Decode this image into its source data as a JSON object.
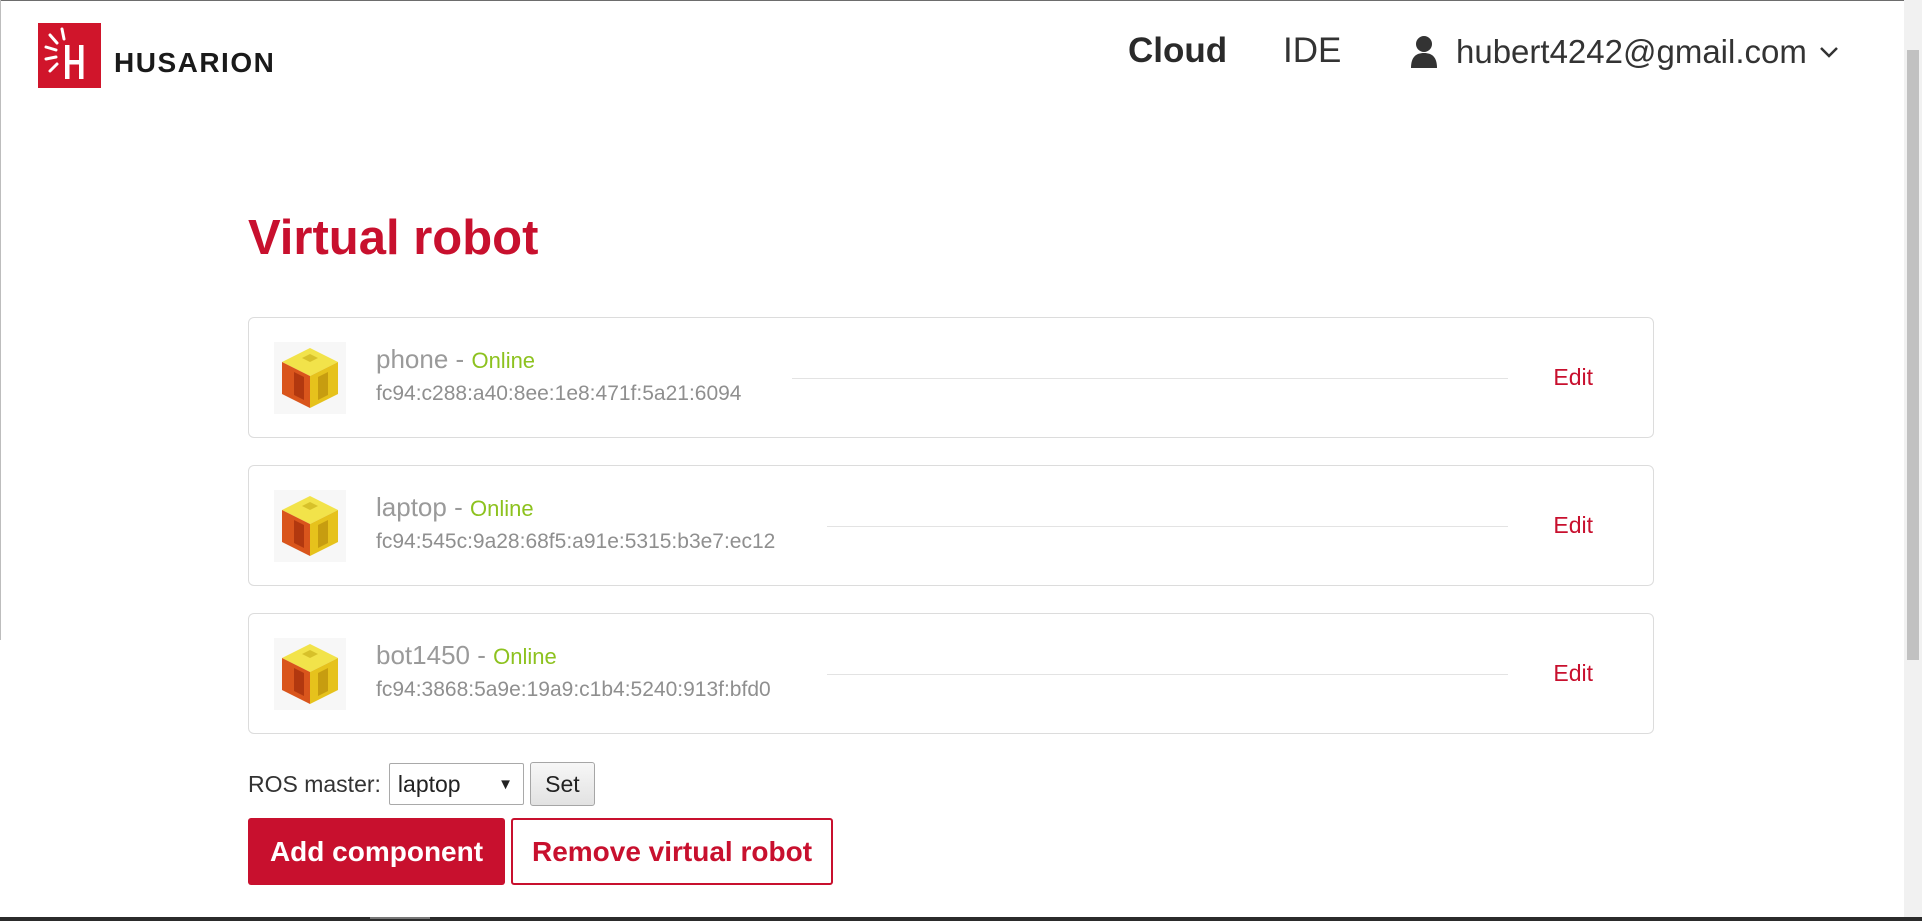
{
  "header": {
    "brand": "HUSARION",
    "nav": [
      {
        "label": "Cloud",
        "active": true
      },
      {
        "label": "IDE",
        "active": false
      }
    ],
    "user": {
      "email": "hubert4242@gmail.com",
      "icon": "user-icon",
      "menu_icon": "chevron-down-icon"
    }
  },
  "page": {
    "title": "Virtual robot"
  },
  "robots": [
    {
      "name": "phone",
      "status": "Online",
      "address": "fc94:c288:a40:8ee:1e8:471f:5a21:6094",
      "edit_label": "Edit"
    },
    {
      "name": "laptop",
      "status": "Online",
      "address": "fc94:545c:9a28:68f5:a91e:5315:b3e7:ec12",
      "edit_label": "Edit"
    },
    {
      "name": "bot1450",
      "status": "Online",
      "address": "fc94:3868:5a9e:19a9:c1b4:5240:913f:bfd0",
      "edit_label": "Edit"
    }
  ],
  "ros_master": {
    "label": "ROS master:",
    "selected": "laptop",
    "set_label": "Set"
  },
  "actions": {
    "add_label": "Add component",
    "remove_label": "Remove virtual robot"
  },
  "colors": {
    "accent": "#c8102e",
    "online": "#8dc21f",
    "muted_text": "#9a9a9a"
  }
}
